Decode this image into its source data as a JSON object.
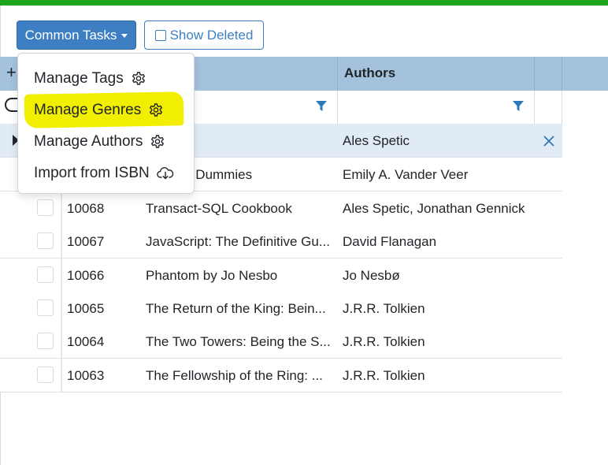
{
  "toolbar": {
    "common_tasks_label": "Common Tasks",
    "show_deleted_label": "Show Deleted"
  },
  "grid": {
    "columns": {
      "authors": "Authors"
    },
    "selected_row": {
      "authors": "Ales Spetic"
    },
    "rows": [
      {
        "id": "",
        "title": "...pt For Dummies",
        "authors": "Emily A. Vander Veer"
      },
      {
        "id": "10068",
        "title": "Transact-SQL Cookbook",
        "authors": "Ales Spetic, Jonathan Gennick"
      },
      {
        "id": "10067",
        "title": "JavaScript: The Definitive Gu...",
        "authors": "David Flanagan"
      },
      {
        "id": "10066",
        "title": "Phantom by Jo Nesbo",
        "authors": "Jo Nesbø"
      },
      {
        "id": "10065",
        "title": "The Return of the King: Bein...",
        "authors": "J.R.R. Tolkien"
      },
      {
        "id": "10064",
        "title": "The Two Towers: Being the S...",
        "authors": "J.R.R. Tolkien"
      },
      {
        "id": "10063",
        "title": "The Fellowship of the Ring: ...",
        "authors": "J.R.R. Tolkien"
      }
    ]
  },
  "menu": {
    "items": [
      {
        "label": "Manage Tags",
        "icon": "gear-icon"
      },
      {
        "label": "Manage Genres",
        "icon": "gear-icon",
        "highlighted": true
      },
      {
        "label": "Manage Authors",
        "icon": "gear-icon"
      },
      {
        "label": "Import from ISBN",
        "icon": "cloud-download-icon"
      }
    ]
  },
  "colors": {
    "accent": "#3d7fc2",
    "header_bg": "#a4c2dc",
    "highlight": "#f2ee00",
    "top_bar": "#1ea51e"
  }
}
